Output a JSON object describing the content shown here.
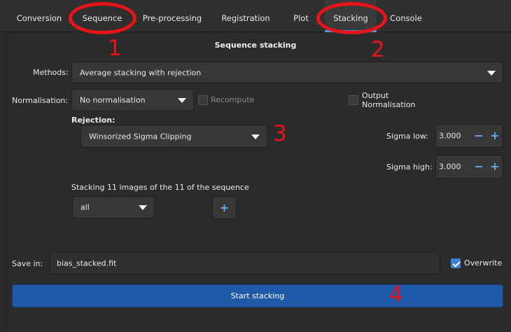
{
  "tabs": [
    {
      "label": "Conversion"
    },
    {
      "label": "Sequence"
    },
    {
      "label": "Pre-processing"
    },
    {
      "label": "Registration"
    },
    {
      "label": "Plot"
    },
    {
      "label": "Stacking"
    },
    {
      "label": "Console"
    }
  ],
  "active_tab": "Stacking",
  "section_title": "Sequence stacking",
  "methods": {
    "label": "Methods:",
    "value": "Average stacking with rejection"
  },
  "normalisation": {
    "label": "Normalisation:",
    "value": "No normalisation"
  },
  "recompute": {
    "label": "Recompute",
    "checked": false
  },
  "output_normalisation": {
    "label_line1": "Output",
    "label_line2": "Normalisation",
    "checked": false
  },
  "rejection": {
    "label": "Rejection:",
    "value": "Winsorized Sigma Clipping"
  },
  "sigma_low": {
    "label": "Sigma low:",
    "value": "3.000"
  },
  "sigma_high": {
    "label": "Sigma high:",
    "value": "3.000"
  },
  "stacking_info": "Stacking 11 images of the 11 of the sequence",
  "filter": {
    "value": "all"
  },
  "save": {
    "label": "Save in:",
    "value": "bias_stacked.fit"
  },
  "overwrite": {
    "label": "Overwrite",
    "checked": true
  },
  "start_button": "Start stacking",
  "annotations": [
    "1",
    "2",
    "3",
    "4"
  ],
  "colors": {
    "accent": "#5294e2",
    "button": "#1f5aa8",
    "annotation": "#e8141a",
    "background": "#2c2c2c"
  },
  "icons": {
    "minus": "−",
    "plus": "+"
  }
}
